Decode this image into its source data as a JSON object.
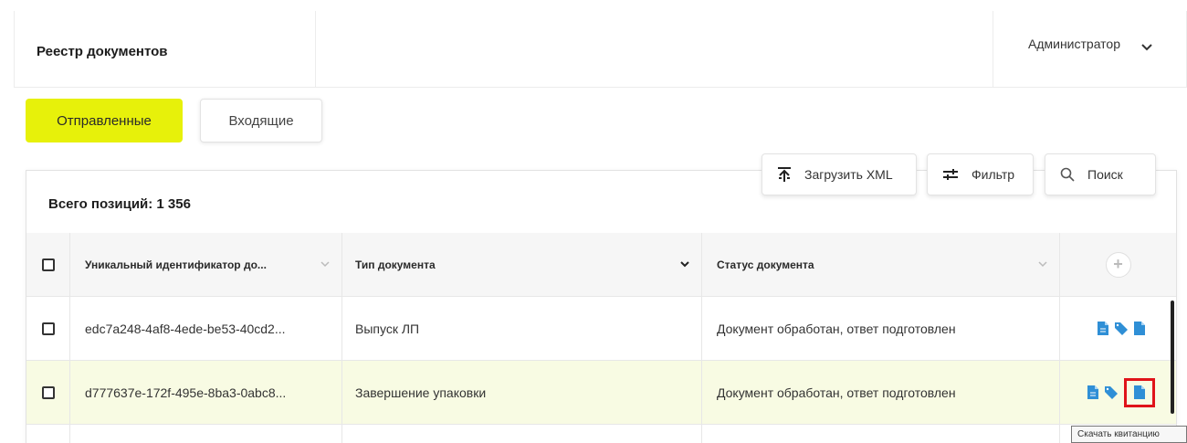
{
  "header": {
    "title": "Реестр документов",
    "user": "Администратор"
  },
  "tabs": [
    {
      "label": "Отправленные",
      "active": true
    },
    {
      "label": "Входящие",
      "active": false
    }
  ],
  "toolbar": {
    "upload_label": "Загрузить XML",
    "filter_label": "Фильтр",
    "search_label": "Поиск"
  },
  "summary": {
    "total": "Всего позиций: 1 356"
  },
  "table": {
    "columns": [
      "Уникальный идентификатор до...",
      "Тип документа",
      "Статус документа"
    ],
    "rows": [
      {
        "id": "edc7a248-4af8-4ede-be53-40cd2...",
        "type": "Выпуск ЛП",
        "status": "Документ обработан, ответ подготовлен",
        "highlighted": false
      },
      {
        "id": "d777637e-172f-495e-8ba3-0abc8...",
        "type": "Завершение упаковки",
        "status": "Документ обработан, ответ подготовлен",
        "highlighted": true
      }
    ]
  },
  "tooltip": {
    "text": "Скачать квитанцию"
  },
  "colors": {
    "accent": "#e7f10a",
    "row_highlight": "#f8fbe3",
    "icon_blue": "#2f8fd6",
    "highlight_box": "#e0131a"
  },
  "icons": [
    "chevron-down-icon",
    "upload-icon",
    "filter-icon",
    "search-icon",
    "plus-icon",
    "document-icon",
    "tag-icon",
    "receipt-icon"
  ]
}
